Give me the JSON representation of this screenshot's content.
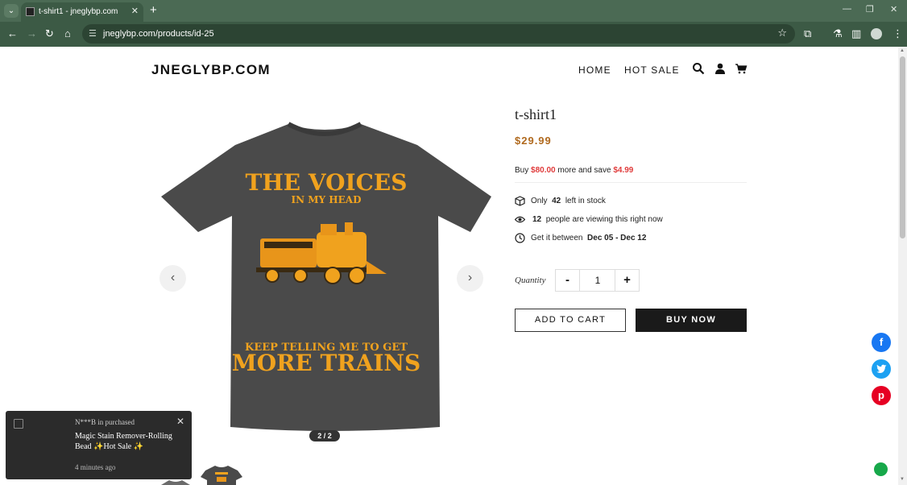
{
  "browser": {
    "tab_title": "t-shirt1 - jneglybp.com",
    "url": "jneglybp.com/products/id-25"
  },
  "header": {
    "logo": "JNEGLYBP.COM",
    "nav": [
      "HOME",
      "HOT SALE"
    ],
    "icons": [
      "search-icon",
      "account-icon",
      "cart-icon"
    ]
  },
  "gallery": {
    "slide_counter": "2 / 2",
    "shirt_text_line1": "THE VOICES",
    "shirt_text_line2": "IN MY HEAD",
    "shirt_text_line3": "KEEP TELLING ME TO GET",
    "shirt_text_line4": "MORE TRAINS",
    "shirt_color": "#4a4a4a",
    "print_color": "#f0a21e"
  },
  "product": {
    "title": "t-shirt1",
    "price": "$29.99",
    "promo_prefix": "Buy",
    "promo_amount": "$80.00",
    "promo_middle": "more and save",
    "promo_save": "$4.99",
    "stock_prefix": "Only",
    "stock_count": "42",
    "stock_suffix": "left in stock",
    "viewers_count": "12",
    "viewers_suffix": "people are viewing this right now",
    "delivery_prefix": "Get it between",
    "delivery_range": "Dec 05 - Dec 12",
    "quantity_label": "Quantity",
    "quantity_minus": "-",
    "quantity_value": "1",
    "quantity_plus": "+",
    "add_to_cart": "ADD TO CART",
    "buy_now": "BUY NOW"
  },
  "social": {
    "facebook_color": "#1877f2",
    "twitter_color": "#1da1f2",
    "pinterest_color": "#e60023"
  },
  "toast": {
    "buyer": "N***B in purchased",
    "product": "Magic Stain Remover-Rolling Bead ✨Hot Sale ✨",
    "time": "4 minutes ago"
  },
  "colors": {
    "chrome": "#3c5a45",
    "price": "#b06a1f",
    "promo_red": "#e03c3c"
  }
}
